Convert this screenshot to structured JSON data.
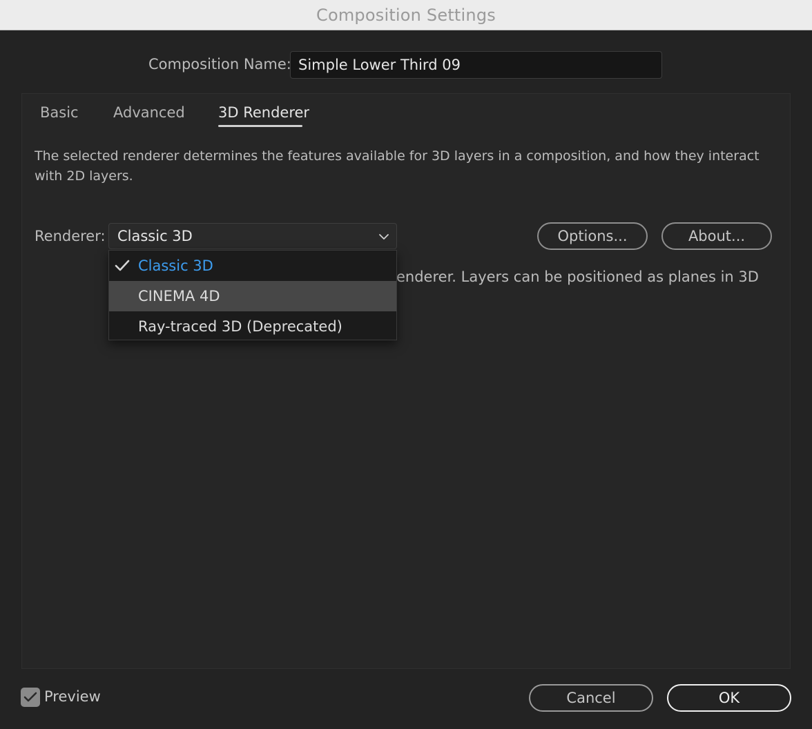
{
  "window": {
    "title": "Composition Settings"
  },
  "composition": {
    "name_label": "Composition Name:",
    "name_value": "Simple Lower Third 09"
  },
  "tabs": [
    {
      "label": "Basic",
      "active": false
    },
    {
      "label": "Advanced",
      "active": false
    },
    {
      "label": "3D Renderer",
      "active": true
    }
  ],
  "renderer_tab": {
    "description": "The selected renderer determines the features available for 3D layers in a composition, and how they interact with 2D layers.",
    "renderer_label": "Renderer:",
    "selected_renderer": "Classic 3D",
    "options_button": "Options...",
    "about_button": "About...",
    "info_text_visible": "enderer. Layers can be positioned as planes in 3D",
    "dropdown_items": [
      {
        "label": "Classic 3D",
        "checked": true
      },
      {
        "label": "CINEMA 4D",
        "checked": false
      },
      {
        "label": "Ray-traced 3D (Deprecated)",
        "checked": false
      }
    ]
  },
  "footer": {
    "preview_label": "Preview",
    "preview_checked": true,
    "cancel_button": "Cancel",
    "ok_button": "OK"
  },
  "colors": {
    "accent_selected": "#3d9df0",
    "dialog_bg": "#232323",
    "titlebar_bg": "#ececec"
  }
}
